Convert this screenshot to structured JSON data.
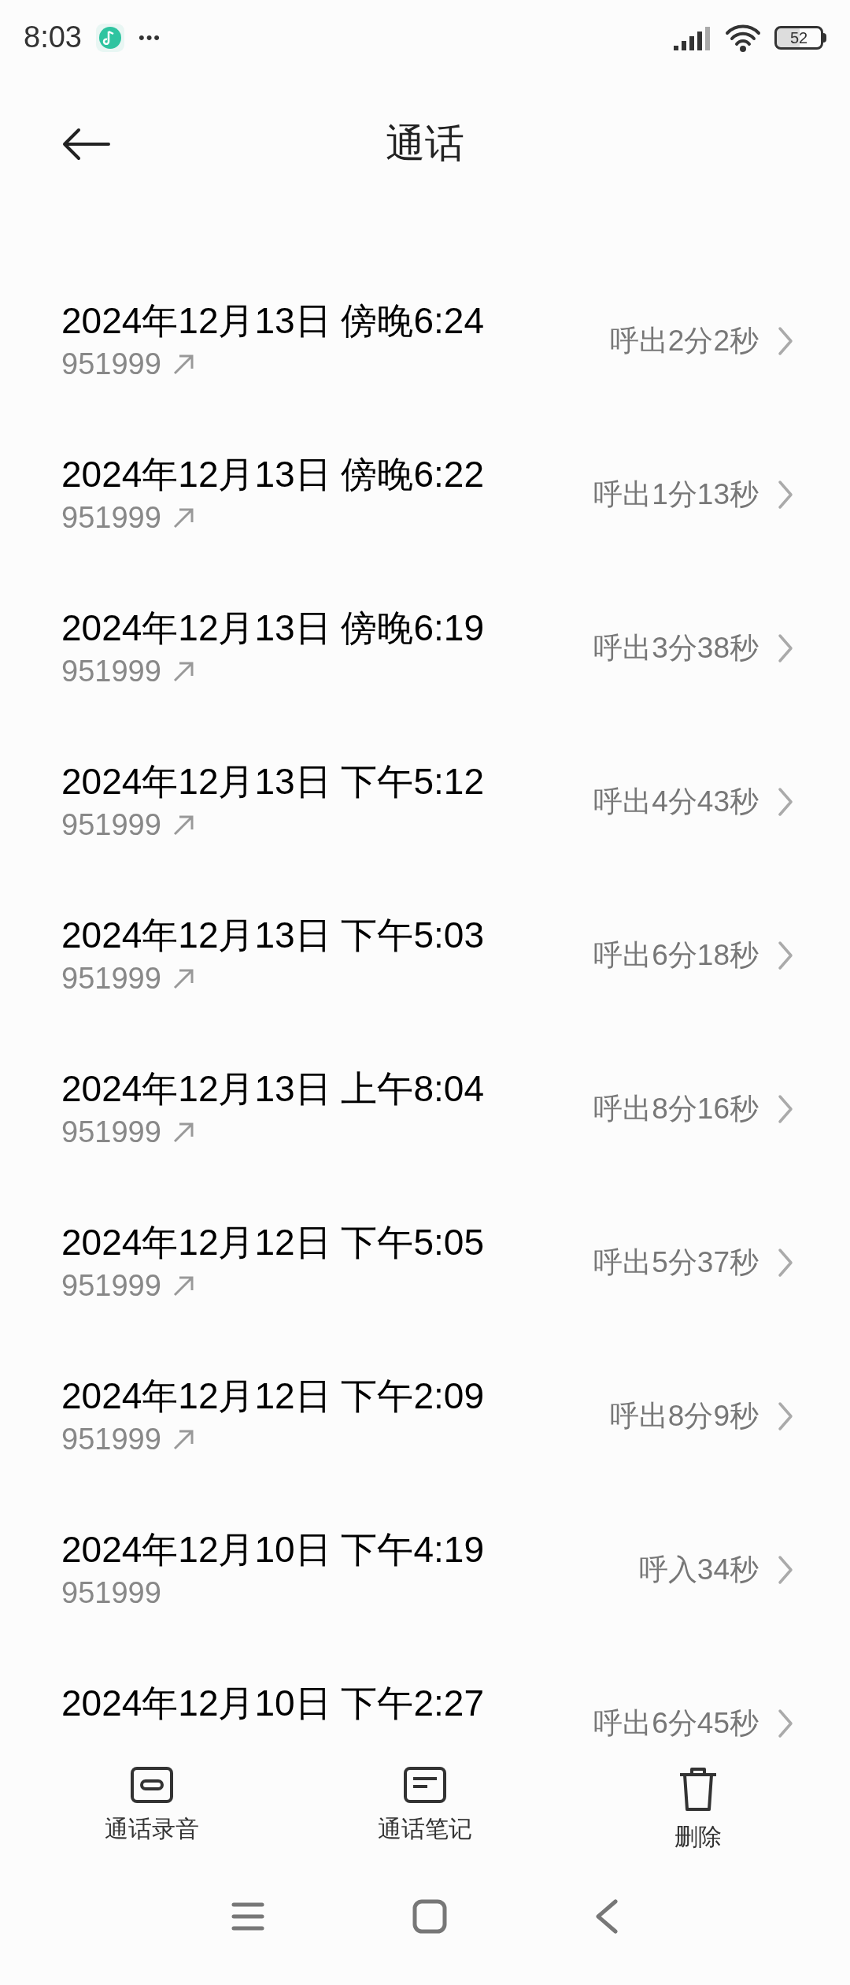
{
  "status_bar": {
    "time": "8:03",
    "more": "•••",
    "battery": "52"
  },
  "header": {
    "title": "通话"
  },
  "calls": [
    {
      "datetime": "2024年12月13日 傍晚6:24",
      "number": "951999",
      "kind": "outgoing",
      "duration": "呼出2分2秒"
    },
    {
      "datetime": "2024年12月13日 傍晚6:22",
      "number": "951999",
      "kind": "outgoing",
      "duration": "呼出1分13秒"
    },
    {
      "datetime": "2024年12月13日 傍晚6:19",
      "number": "951999",
      "kind": "outgoing",
      "duration": "呼出3分38秒"
    },
    {
      "datetime": "2024年12月13日 下午5:12",
      "number": "951999",
      "kind": "outgoing",
      "duration": "呼出4分43秒"
    },
    {
      "datetime": "2024年12月13日 下午5:03",
      "number": "951999",
      "kind": "outgoing",
      "duration": "呼出6分18秒"
    },
    {
      "datetime": "2024年12月13日 上午8:04",
      "number": "951999",
      "kind": "outgoing",
      "duration": "呼出8分16秒"
    },
    {
      "datetime": "2024年12月12日 下午5:05",
      "number": "951999",
      "kind": "outgoing",
      "duration": "呼出5分37秒"
    },
    {
      "datetime": "2024年12月12日 下午2:09",
      "number": "951999",
      "kind": "outgoing",
      "duration": "呼出8分9秒"
    },
    {
      "datetime": "2024年12月10日 下午4:19",
      "number": "951999",
      "kind": "incoming",
      "duration": "呼入34秒"
    },
    {
      "datetime": "2024年12月10日 下午2:27",
      "duration": "呼出6分45秒"
    }
  ],
  "actions": [
    {
      "kind": "recording",
      "label": "通话录音"
    },
    {
      "kind": "notes",
      "label": "通话笔记"
    },
    {
      "kind": "delete",
      "label": "删除"
    }
  ]
}
